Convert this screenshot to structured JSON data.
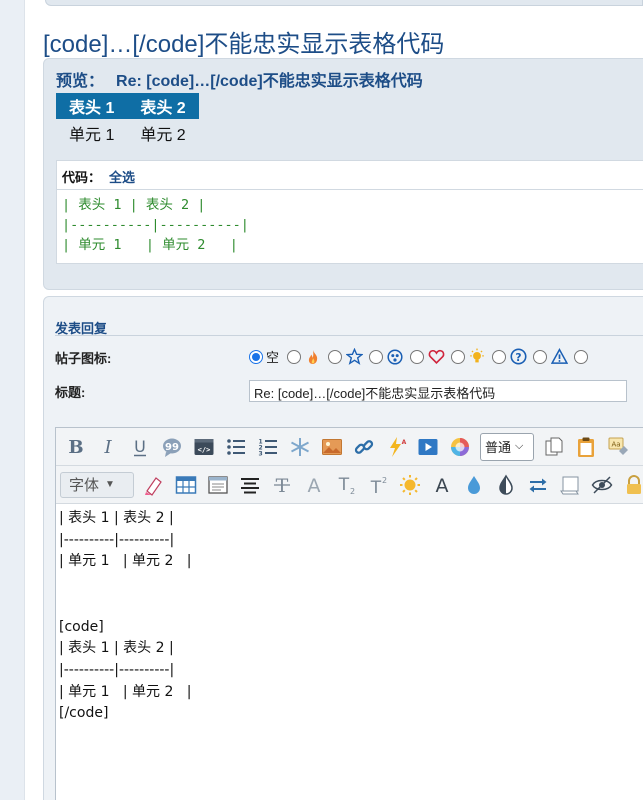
{
  "page": {
    "title": "[code]…[/code]不能忠实显示表格代码"
  },
  "preview": {
    "label": "预览：",
    "title": "Re: [code]…[/code]不能忠实显示表格代码",
    "table": {
      "headers": [
        "表头 1",
        "表头 2"
      ],
      "rows": [
        [
          "单元 1",
          "单元 2"
        ]
      ]
    },
    "code": {
      "label": "代码：",
      "select_all": "全选",
      "lines": [
        "| 表头 1 | 表头 2 |",
        "|----------|----------|",
        "| 单元 1   | 单元 2   |"
      ]
    }
  },
  "reply": {
    "title": "发表回复",
    "post_icon_label": "帖子图标:",
    "post_icon_options": [
      {
        "text": "空",
        "checked": true
      },
      {
        "icon": "fire-icon"
      },
      {
        "icon": "star-icon"
      },
      {
        "icon": "smiley-icon"
      },
      {
        "icon": "heart-icon"
      },
      {
        "icon": "lightbulb-icon"
      },
      {
        "icon": "question-icon"
      },
      {
        "icon": "warning-icon"
      }
    ],
    "subject_label": "标题:",
    "subject_value": "Re: [code]…[/code]不能忠实显示表格代码",
    "toolbar": {
      "format_select": "普通",
      "font_button": "字体",
      "row1_icons": [
        "bold-icon",
        "italic-icon",
        "underline-icon",
        "quote-icon",
        "code-icon",
        "bullet-list-icon",
        "numbered-list-icon",
        "list-item-icon",
        "image-icon",
        "link-icon",
        "flash-icon",
        "video-icon",
        "color-icon",
        "copy-icon",
        "paste-icon",
        "remove-format-icon"
      ],
      "row2_icons": [
        "highlight-icon",
        "table-icon",
        "window-icon",
        "align-center-icon",
        "strikethrough-icon",
        "size-icon",
        "subscript-icon",
        "superscript-icon",
        "sun-icon",
        "font-a-icon",
        "drop-icon",
        "contrast-icon",
        "swap-icon",
        "scroll-icon",
        "hide-icon",
        "lock-icon"
      ]
    },
    "editor_text": "| 表头 1 | 表头 2 |\n|----------|----------|\n| 单元 1   | 单元 2   |\n\n\n[code]\n| 表头 1 | 表头 2 |\n|----------|----------|\n| 单元 1   | 单元 2   |\n[/code]"
  },
  "colors": {
    "link_blue": "#1d4d87",
    "table_header": "#0f6ea5",
    "code_green": "#2e8b2e"
  }
}
